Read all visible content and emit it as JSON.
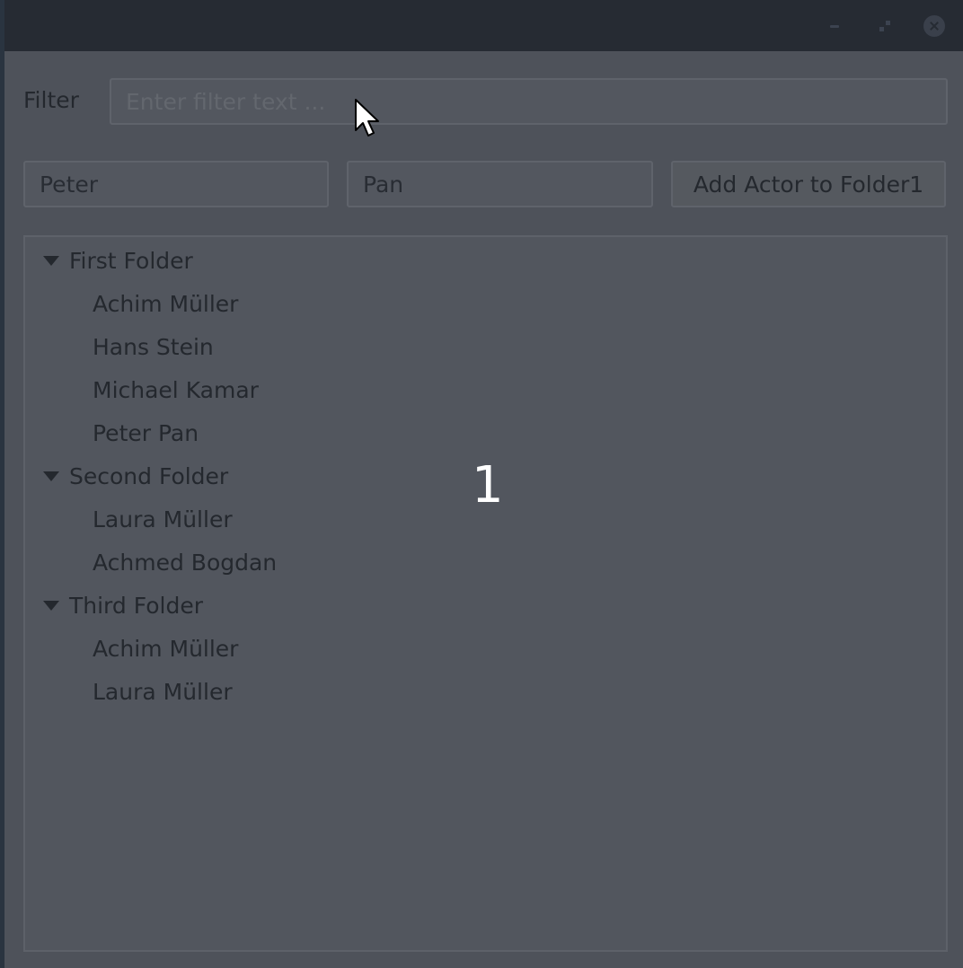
{
  "filter": {
    "label": "Filter",
    "placeholder": "Enter filter text ..."
  },
  "form": {
    "first_name_value": "Peter",
    "last_name_value": "Pan",
    "add_button_label": "Add Actor to Folder1"
  },
  "tree": {
    "folders": [
      {
        "name": "First Folder",
        "expanded": true,
        "items": [
          "Achim Müller",
          "Hans Stein",
          "Michael Kamar",
          "Peter Pan"
        ]
      },
      {
        "name": "Second Folder",
        "expanded": true,
        "items": [
          "Laura Müller",
          "Achmed Bogdan"
        ]
      },
      {
        "name": "Third Folder",
        "expanded": true,
        "items": [
          "Achim Müller",
          "Laura Müller"
        ]
      }
    ]
  },
  "overlay": {
    "step_number": "1"
  },
  "icons": {
    "minimize": "minimize-icon",
    "maximize": "maximize-icon",
    "close": "close-icon",
    "disclosure": "triangle-down-icon",
    "cursor": "mouse-pointer-icon"
  }
}
